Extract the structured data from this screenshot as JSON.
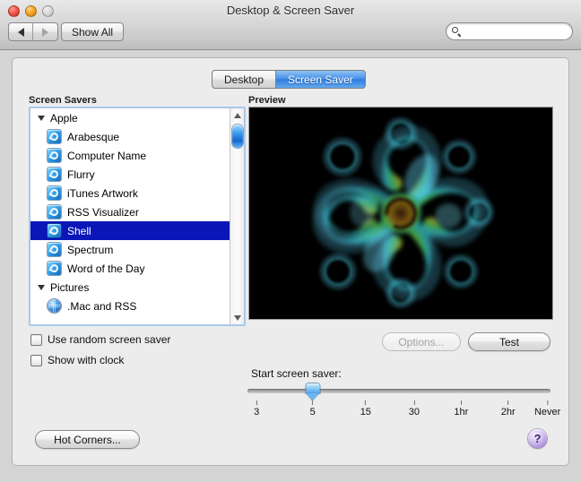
{
  "window": {
    "title": "Desktop & Screen Saver",
    "traffic_lights": {
      "close": "close",
      "minimize": "minimize",
      "zoom": "zoom"
    }
  },
  "toolbar": {
    "back_icon": "left-arrow-icon",
    "forward_icon": "right-arrow-icon",
    "show_all_label": "Show All",
    "search": {
      "icon": "search-icon",
      "value": "",
      "placeholder": ""
    }
  },
  "tabs": [
    {
      "label": "Desktop",
      "active": false
    },
    {
      "label": "Screen Saver",
      "active": true
    }
  ],
  "panes": {
    "screen_savers_label": "Screen Savers",
    "preview_label": "Preview"
  },
  "screen_saver_list": [
    {
      "type": "group",
      "label": "Apple",
      "expanded": true,
      "icon": "disclosure-triangle-icon"
    },
    {
      "type": "item",
      "label": "Arabesque",
      "icon": "screen-saver-icon",
      "selected": false
    },
    {
      "type": "item",
      "label": "Computer Name",
      "icon": "screen-saver-icon",
      "selected": false
    },
    {
      "type": "item",
      "label": "Flurry",
      "icon": "screen-saver-icon",
      "selected": false
    },
    {
      "type": "item",
      "label": "iTunes Artwork",
      "icon": "screen-saver-icon",
      "selected": false
    },
    {
      "type": "item",
      "label": "RSS Visualizer",
      "icon": "screen-saver-icon",
      "selected": false
    },
    {
      "type": "item",
      "label": "Shell",
      "icon": "screen-saver-icon",
      "selected": true
    },
    {
      "type": "item",
      "label": "Spectrum",
      "icon": "screen-saver-icon",
      "selected": false
    },
    {
      "type": "item",
      "label": "Word of the Day",
      "icon": "screen-saver-icon",
      "selected": false
    },
    {
      "type": "group",
      "label": "Pictures",
      "expanded": true,
      "icon": "disclosure-triangle-icon"
    },
    {
      "type": "item",
      "label": ".Mac and RSS",
      "icon": "globe-icon",
      "selected": false
    }
  ],
  "preview": {
    "content": "spiral-fractal-animation",
    "background_color": "#000000",
    "fractal_colors": [
      "#00c4ff",
      "#7fe3d8",
      "#9fd84a",
      "#d4c23a",
      "#6b3a1e",
      "#1f6f6a"
    ]
  },
  "checkboxes": [
    {
      "label": "Use random screen saver",
      "checked": false
    },
    {
      "label": "Show with clock",
      "checked": false
    }
  ],
  "buttons": {
    "options_label": "Options...",
    "options_enabled": false,
    "test_label": "Test",
    "test_enabled": true,
    "hot_corners_label": "Hot Corners...",
    "help_label": "?"
  },
  "slider": {
    "label": "Start screen saver:",
    "value_index": 1,
    "value_label": "5",
    "ticks": [
      {
        "label": "3",
        "pos_pct": 3
      },
      {
        "label": "5",
        "pos_pct": 21.5
      },
      {
        "label": "15",
        "pos_pct": 39
      },
      {
        "label": "30",
        "pos_pct": 55
      },
      {
        "label": "1hr",
        "pos_pct": 70.5
      },
      {
        "label": "2hr",
        "pos_pct": 86
      },
      {
        "label": "Never",
        "pos_pct": 99
      }
    ]
  },
  "colors": {
    "selection_blue": "#0b16b8",
    "tab_active_blue": "#2f7ee0",
    "window_chrome": "#d4d4d4",
    "content_bg": "#ececec",
    "help_purple": "#a989da"
  }
}
